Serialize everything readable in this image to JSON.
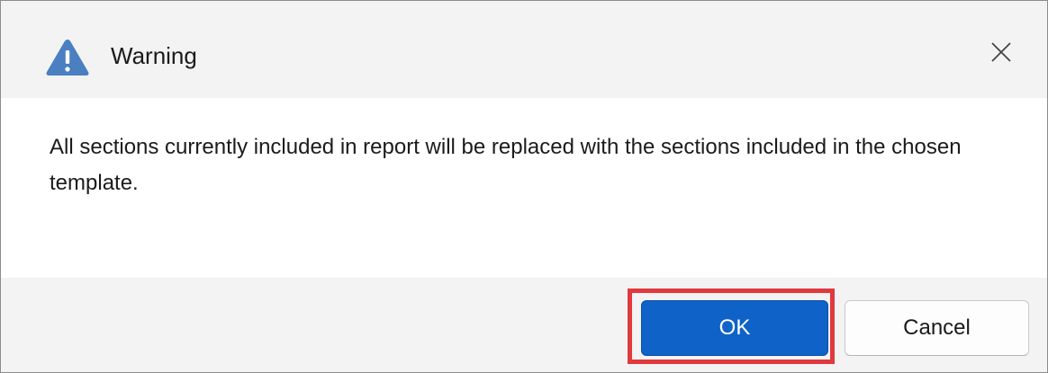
{
  "dialog": {
    "title": "Warning",
    "icon": "warning-triangle-icon",
    "close_icon": "close-icon",
    "message": "All sections currently included in report will be replaced with the sections included in the chosen template.",
    "buttons": {
      "ok_label": "OK",
      "cancel_label": "Cancel"
    }
  },
  "colors": {
    "icon_blue": "#4a7fc1",
    "primary_button": "#0f63c8",
    "highlight_border": "#e0393e",
    "header_footer_bg": "#f3f3f3"
  }
}
